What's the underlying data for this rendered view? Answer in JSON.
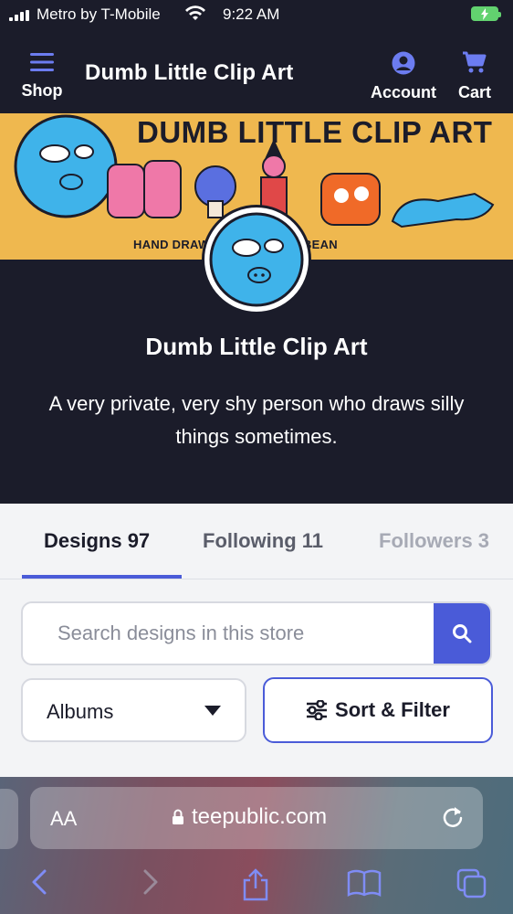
{
  "status_bar": {
    "carrier": "Metro by T-Mobile",
    "time": "9:22 AM"
  },
  "nav": {
    "shop_label": "Shop",
    "brand": "Dumb Little Clip Art",
    "account_label": "Account",
    "cart_label": "Cart"
  },
  "banner": {
    "title": "DUMB LITTLE CLIP ART",
    "subtitle": "HAND DRAWN BY A HUMAN BEAN"
  },
  "profile": {
    "name": "Dumb Little Clip Art",
    "description": "A very private, very shy person who draws silly things sometimes."
  },
  "tabs": [
    {
      "label": "Designs 97"
    },
    {
      "label": "Following 11"
    },
    {
      "label": "Followers 3"
    }
  ],
  "search": {
    "placeholder": "Search designs in this store"
  },
  "filters": {
    "albums_value": "Albums",
    "sort_label": "Sort & Filter"
  },
  "browser": {
    "text_size": "AA",
    "domain": "teepublic.com"
  },
  "colors": {
    "accent": "#4a5bd8",
    "dark_bg": "#1b1c2a",
    "banner_bg": "#efb84f"
  }
}
